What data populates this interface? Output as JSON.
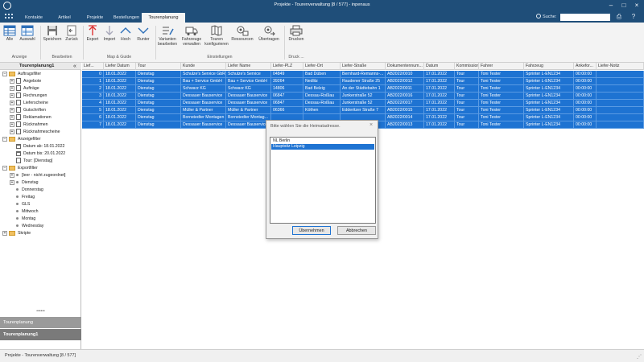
{
  "window": {
    "title": "Projekte - Tourenverwaltung [8 / 577] - inpenaus"
  },
  "tabs": [
    {
      "label": "Kontakte"
    },
    {
      "label": "Artikel"
    },
    {
      "label": "Projekte"
    },
    {
      "label": "Bestellungen"
    },
    {
      "label": "Tourenplanung"
    }
  ],
  "search": {
    "label": "Suche:",
    "value": ""
  },
  "ribbon": {
    "buttons": [
      {
        "label": "Alle"
      },
      {
        "label": "Auswahl"
      },
      {
        "label": "Speichern"
      },
      {
        "label": "Zurück"
      },
      {
        "label": "Export"
      },
      {
        "label": "Import"
      },
      {
        "label": "Hoch"
      },
      {
        "label": "Runter"
      },
      {
        "label": "Varianten bearbeiten"
      },
      {
        "label": "Fahrzeuge verwalten"
      },
      {
        "label": "Touren konfigurieren"
      },
      {
        "label": "Ressourcen"
      },
      {
        "label": "Übertragen"
      },
      {
        "label": "Drucken"
      }
    ],
    "groups": [
      {
        "label": "Anzeige"
      },
      {
        "label": "Bearbeiten"
      },
      {
        "label": "Map & Guide"
      },
      {
        "label": "Einstellungen"
      },
      {
        "label": "Druck ..."
      }
    ]
  },
  "sidebar": {
    "header": "Tourenplanung1",
    "collapse": "«",
    "tree": [
      {
        "label": "Auftragsfilter"
      },
      {
        "label": "Angebote"
      },
      {
        "label": "Aufträge"
      },
      {
        "label": "Rechnungen"
      },
      {
        "label": "Lieferscheine"
      },
      {
        "label": "Gutschriften"
      },
      {
        "label": "Reklamationen"
      },
      {
        "label": "Rücknahmen"
      },
      {
        "label": "Rücknahmescheine"
      },
      {
        "label": "Anzeigefilter"
      },
      {
        "label": "Datum ab: 18.01.2022"
      },
      {
        "label": "Datum bis: 20.01.2022"
      },
      {
        "label": "Tour: [Dienstag]"
      },
      {
        "label": "Exportfilter"
      },
      {
        "label": "[leer - nicht zugeordnet]"
      },
      {
        "label": "Dienstag"
      },
      {
        "label": "Donnerstag"
      },
      {
        "label": "Freitag"
      },
      {
        "label": "GLS"
      },
      {
        "label": "Mittwoch"
      },
      {
        "label": "Montag"
      },
      {
        "label": "Wednesday"
      },
      {
        "label": "Skripte"
      }
    ],
    "grip": "••••••",
    "nav": [
      {
        "label": "Tourenplanung"
      },
      {
        "label": "Tourenplanung1"
      }
    ]
  },
  "grid": {
    "columns": [
      "Lief...",
      "Liefer Datum",
      "Tour",
      "Kunde",
      "Liefer Name",
      "Liefer-PLZ",
      "Liefer-Ort",
      "Liefer-Straße",
      "Dokumentennum...",
      "Datum",
      "Kommission",
      "Fahrer",
      "Fahrzeug",
      "Ankefor...",
      "Liefer-Notiz"
    ],
    "rows": [
      [
        "0",
        "18.01.2022",
        "Dienstag",
        "Schulze's Service GbR",
        "Schulze's Service",
        "04849",
        "Bad Düben",
        "Bernhard-Remanns-...",
        "AB2022/0010",
        "17.01.2022",
        "Tour",
        "Toni Tester",
        "Sprinter L-EN1234",
        "00:00:00",
        ""
      ],
      [
        "1",
        "18.01.2022",
        "Dienstag",
        "Bau + Service GmbH",
        "Bau + Service GmbH",
        "39264",
        "Nedlitz",
        "Raudener Straße 25",
        "AB2022/0012",
        "17.01.2022",
        "Tour",
        "Toni Tester",
        "Sprinter L-EN1234",
        "00:00:00",
        ""
      ],
      [
        "2",
        "18.01.2022",
        "Dienstag",
        "Schwarz KG",
        "Schwarz KG",
        "14806",
        "Bad Belzig",
        "An der Städtebahn 1",
        "AB2022/0011",
        "17.01.2022",
        "Tour",
        "Toni Tester",
        "Sprinter L-EN1234",
        "00:00:00",
        ""
      ],
      [
        "3",
        "18.01.2022",
        "Dienstag",
        "Dessauer Bauservice",
        "Dessauer Bauservice",
        "06847",
        "Dessau-Roßlau",
        "Junkerstraße 52",
        "AB2022/0016",
        "17.01.2022",
        "Tour",
        "Toni Tester",
        "Sprinter L-EN1234",
        "00:00:00",
        ""
      ],
      [
        "4",
        "18.01.2022",
        "Dienstag",
        "Dessauer Bauservice",
        "Dessauer Bauservice",
        "06847",
        "Dessau-Roßlau",
        "Junkerstraße 52",
        "AB2022/0017",
        "17.01.2022",
        "Tour",
        "Toni Tester",
        "Sprinter L-EN1234",
        "00:00:00",
        ""
      ],
      [
        "5",
        "18.01.2022",
        "Dienstag",
        "Müller & Partner",
        "Müller & Partner",
        "06366",
        "Köthen",
        "Edderitzer Straße 7",
        "AB2022/0015",
        "17.01.2022",
        "Tour",
        "Toni Tester",
        "Sprinter L-EN1234",
        "00:00:00",
        ""
      ],
      [
        "6",
        "18.01.2022",
        "Dienstag",
        "Bornstedter Montagen",
        "Bornstedter Montag...",
        "",
        "",
        "",
        "AB2022/0014",
        "17.01.2022",
        "Tour",
        "Toni Tester",
        "Sprinter L-EN1234",
        "00:00:00",
        ""
      ],
      [
        "7",
        "18.01.2022",
        "Dienstag",
        "Dessauer Bauservice",
        "Dessauer Bauservice",
        "",
        "",
        "",
        "AB2022/0013",
        "17.01.2022",
        "Tour",
        "Toni Tester",
        "Sprinter L-EN1234",
        "00:00:00",
        ""
      ]
    ]
  },
  "status": {
    "text": "Projekte - Tourenverwaltung [8 / 577]"
  },
  "dialog": {
    "title": "Bitte wählen Sie die Heimatadresse.",
    "close": "×",
    "items": [
      {
        "label": "NL Berlin"
      },
      {
        "label": "Hauptsitz Leipzig"
      }
    ],
    "ok": "Übernehmen",
    "cancel": "Abbrechen"
  },
  "colors": {
    "accent": "#1e73d2",
    "titlebar": "#1f4e79"
  }
}
